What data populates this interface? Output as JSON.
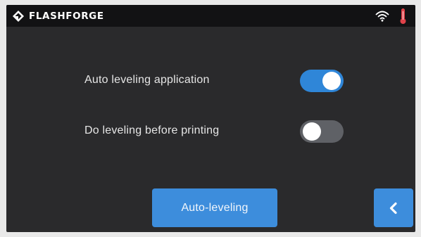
{
  "header": {
    "brand_name": "FLASHFORGE",
    "icons": [
      "flashforge-logo-icon",
      "wifi-icon",
      "thermometer-icon"
    ]
  },
  "settings": [
    {
      "label": "Auto leveling application",
      "enabled": true
    },
    {
      "label": "Do leveling before printing",
      "enabled": false
    }
  ],
  "actions": {
    "auto_leveling_label": "Auto-leveling",
    "back_icon": "chevron-left-icon"
  },
  "colors": {
    "accent": "#3d8ddc",
    "toggle_on": "#2f86d8",
    "toggle_off": "#5f6166",
    "background": "#2a2a2c",
    "header": "#121214",
    "thermometer": "#e0424a"
  }
}
